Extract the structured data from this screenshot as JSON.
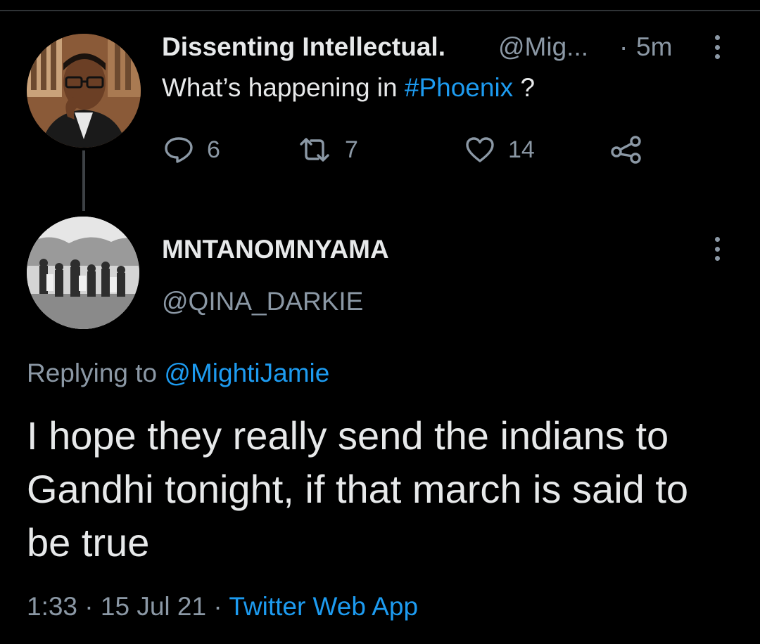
{
  "parent_tweet": {
    "display_name": "Dissenting Intellectual.",
    "handle": "@Mig...",
    "separator": "·",
    "time": "5m",
    "text_prefix": "What’s happening in ",
    "hashtag": "#Phoenix",
    "text_suffix": " ?",
    "avatar_icon": "profile-photo",
    "actions": {
      "reply_count": "6",
      "retweet_count": "7",
      "like_count": "14"
    }
  },
  "reply_tweet": {
    "display_name": "MNTANOMNYAMA",
    "handle": "@QINA_DARKIE",
    "avatar_icon": "profile-photo",
    "replying_prefix": "Replying to ",
    "replying_to": "@MightiJamie",
    "text": "I hope they really send the indians to Gandhi tonight, if that march is said to be true",
    "time": "1:33",
    "separator": "·",
    "date": "15 Jul 21",
    "source": "Twitter Web App"
  },
  "colors": {
    "background": "#000000",
    "primary_text": "#e7e9ea",
    "secondary_text": "#8b98a5",
    "accent": "#1d9bf0"
  }
}
